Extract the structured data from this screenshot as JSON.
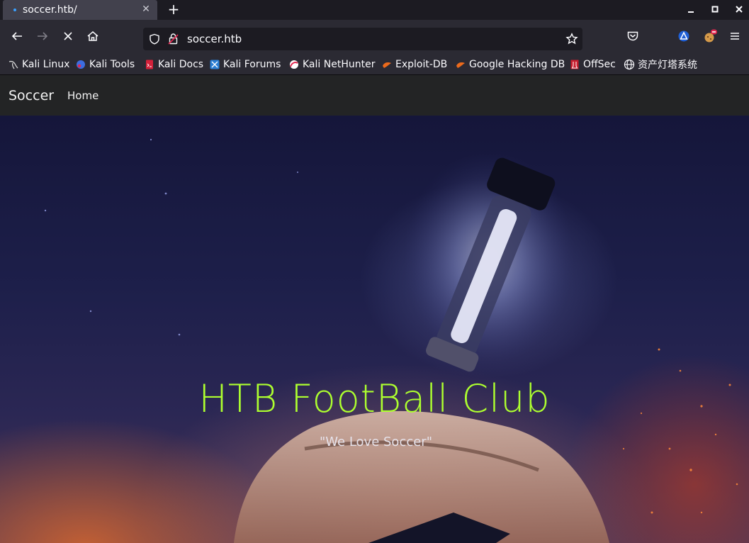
{
  "browser": {
    "tab": {
      "title": "soccer.htb/"
    },
    "url": "soccer.htb",
    "bookmarks": [
      {
        "label": "Kali Linux",
        "icon": "kali-dragon-icon"
      },
      {
        "label": "Kali Tools",
        "icon": "kali-tools-icon"
      },
      {
        "label": "Kali Docs",
        "icon": "kali-docs-icon"
      },
      {
        "label": "Kali Forums",
        "icon": "kali-forums-icon"
      },
      {
        "label": "Kali NetHunter",
        "icon": "nethunter-icon"
      },
      {
        "label": "Exploit-DB",
        "icon": "exploit-db-icon"
      },
      {
        "label": "Google Hacking DB",
        "icon": "ghdb-icon"
      },
      {
        "label": "OffSec",
        "icon": "offsec-icon"
      },
      {
        "label": "资产灯塔系统",
        "icon": "globe-icon"
      }
    ]
  },
  "site": {
    "brand": "Soccer",
    "nav": {
      "home": "Home"
    },
    "hero": {
      "title": "HTB FootBall Club",
      "subtitle": "\"We Love Soccer\""
    }
  },
  "colors": {
    "hero_title": "#adff2f",
    "site_navbar": "#232425",
    "toolbar": "#2b2a33"
  }
}
